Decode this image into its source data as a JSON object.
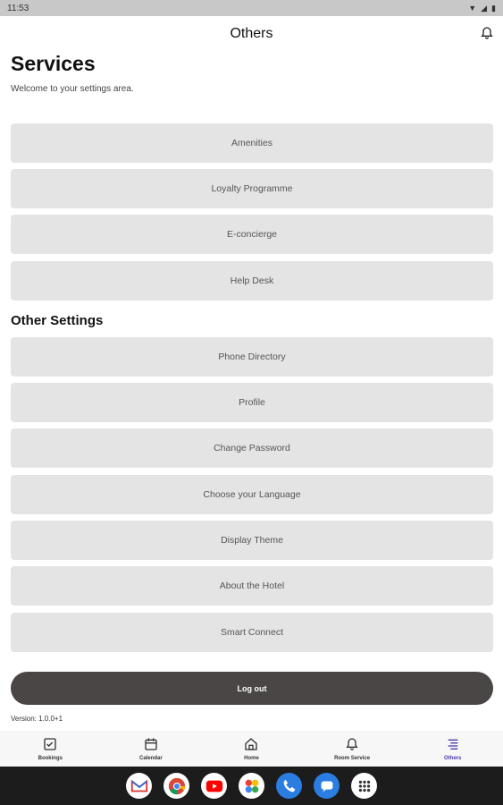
{
  "status_bar": {
    "time": "11:53"
  },
  "app_bar": {
    "title": "Others"
  },
  "page": {
    "title": "Services",
    "subtitle": "Welcome to your settings area."
  },
  "services": [
    {
      "label": "Amenities"
    },
    {
      "label": "Loyalty Programme"
    },
    {
      "label": "E-concierge"
    },
    {
      "label": "Help Desk"
    }
  ],
  "other_settings": {
    "title": "Other Settings",
    "items": [
      {
        "label": "Phone Directory"
      },
      {
        "label": "Profile"
      },
      {
        "label": "Change Password"
      },
      {
        "label": "Choose your Language"
      },
      {
        "label": "Display Theme"
      },
      {
        "label": "About the Hotel"
      },
      {
        "label": "Smart Connect"
      }
    ]
  },
  "logout": {
    "label": "Log out"
  },
  "version": "Version: 1.0.0+1",
  "bottom_nav": [
    {
      "label": "Bookings",
      "icon": "check-square-icon"
    },
    {
      "label": "Calendar",
      "icon": "calendar-icon"
    },
    {
      "label": "Home",
      "icon": "home-icon"
    },
    {
      "label": "Room Service",
      "icon": "bell-icon"
    },
    {
      "label": "Others",
      "icon": "menu-list-icon",
      "active": true
    }
  ],
  "dock_apps": [
    "gmail-icon",
    "chrome-icon",
    "youtube-icon",
    "photos-icon",
    "phone-icon",
    "messages-icon",
    "app-drawer-icon"
  ],
  "colors": {
    "button_bg": "#e4e4e4",
    "logout_bg": "#4a4646",
    "active_nav": "#4a3aa8",
    "status_bar": "#c8c8c8"
  }
}
